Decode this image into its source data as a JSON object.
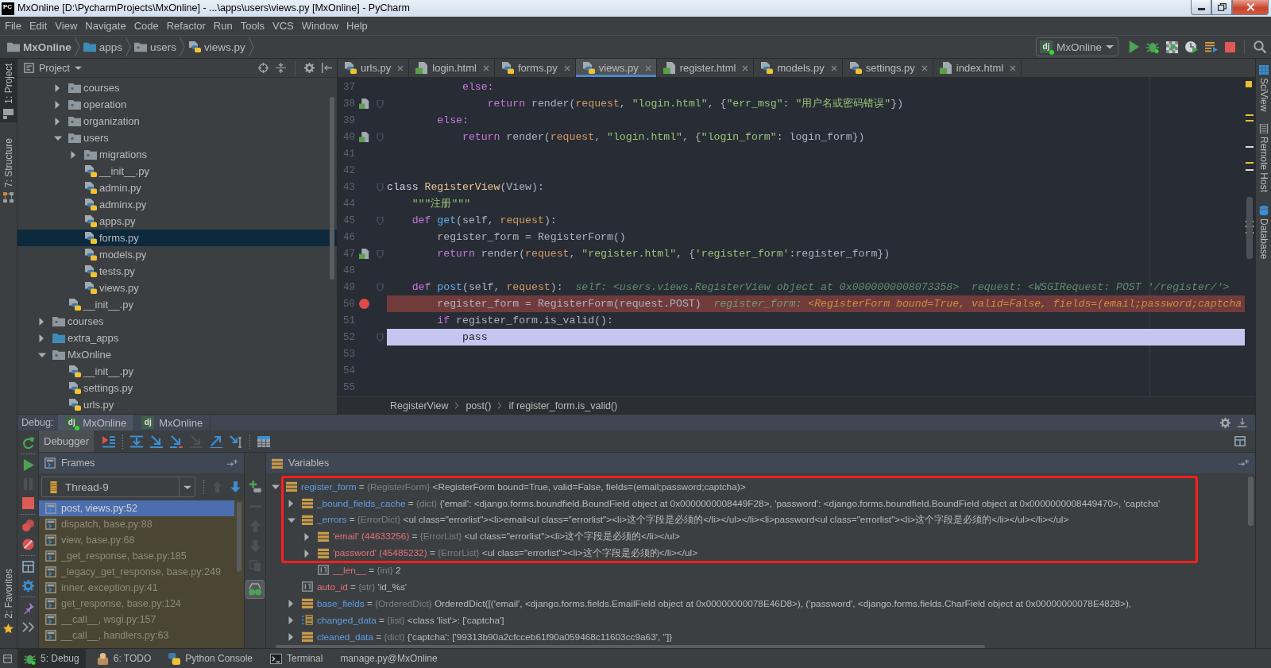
{
  "window": {
    "logo_text": "PC",
    "title": "MxOnline [D:\\PycharmProjects\\MxOnline] - ...\\apps\\users\\views.py [MxOnline] - PyCharm"
  },
  "menu": [
    "File",
    "Edit",
    "View",
    "Navigate",
    "Code",
    "Refactor",
    "Run",
    "Tools",
    "VCS",
    "Window",
    "Help"
  ],
  "navigation_bar": {
    "breadcrumbs": [
      {
        "label": "MxOnline",
        "kind": "project"
      },
      {
        "label": "apps",
        "kind": "source_folder"
      },
      {
        "label": "users",
        "kind": "package"
      },
      {
        "label": "views.py",
        "kind": "python_file"
      }
    ],
    "run_configuration": {
      "logo_text": "dj",
      "label": "MxOnline",
      "running": true
    }
  },
  "left_tool_strip": {
    "top": [
      {
        "label": "1: Project",
        "kind": "project",
        "selected": true
      },
      {
        "label": "7: Structure",
        "kind": "structure",
        "selected": false
      }
    ],
    "bottom": [
      {
        "label": "2: Favorites",
        "kind": "favorites",
        "selected": false
      }
    ]
  },
  "project_panel": {
    "title": "Project",
    "tree": [
      {
        "children": [
          {
            "label": "courses",
            "kind": "package",
            "expanded": false,
            "selected": false
          },
          {
            "label": "operation",
            "kind": "package",
            "expanded": false,
            "selected": false
          },
          {
            "label": "organization",
            "kind": "package",
            "expanded": false,
            "selected": false
          },
          {
            "label": "users",
            "kind": "package",
            "expanded": true,
            "selected": false,
            "children": [
              {
                "label": "migrations",
                "kind": "package",
                "expanded": false,
                "selected": false
              },
              {
                "label": "__init__.py",
                "kind": "python_file",
                "selected": false
              },
              {
                "label": "admin.py",
                "kind": "python_file",
                "selected": false
              },
              {
                "label": "adminx.py",
                "kind": "python_file",
                "selected": false
              },
              {
                "label": "apps.py",
                "kind": "python_file",
                "selected": false
              },
              {
                "label": "forms.py",
                "kind": "python_file",
                "selected": true
              },
              {
                "label": "models.py",
                "kind": "python_file",
                "selected": false
              },
              {
                "label": "tests.py",
                "kind": "python_file",
                "selected": false
              },
              {
                "label": "views.py",
                "kind": "python_file",
                "selected": false
              }
            ]
          },
          {
            "label": "__init__.py",
            "kind": "python_file",
            "selected": false
          }
        ]
      },
      {
        "label": "courses",
        "kind": "package",
        "expanded": false,
        "selected": false
      },
      {
        "label": "extra_apps",
        "kind": "source_folder",
        "expanded": false,
        "selected": false
      },
      {
        "label": "MxOnline",
        "kind": "package",
        "expanded": true,
        "selected": false,
        "children": [
          {
            "label": "__init__.py",
            "kind": "python_file",
            "selected": false
          },
          {
            "label": "settings.py",
            "kind": "python_file",
            "selected": false
          },
          {
            "label": "urls.py",
            "kind": "python_file",
            "selected": false
          }
        ]
      }
    ]
  },
  "editor": {
    "tabs": [
      {
        "label": "urls.py",
        "kind": "python",
        "selected": false
      },
      {
        "label": "login.html",
        "kind": "html",
        "selected": false
      },
      {
        "label": "forms.py",
        "kind": "python",
        "selected": false
      },
      {
        "label": "views.py",
        "kind": "python",
        "selected": true
      },
      {
        "label": "register.html",
        "kind": "html",
        "selected": false
      },
      {
        "label": "models.py",
        "kind": "python",
        "selected": false
      },
      {
        "label": "settings.py",
        "kind": "python",
        "selected": false
      },
      {
        "label": "index.html",
        "kind": "html",
        "selected": false
      }
    ],
    "lines": [
      {
        "number": "37",
        "tokens": [
          {
            "kind": "keyword",
            "text": "            else:"
          }
        ],
        "breakpoint": false,
        "execution_point": false,
        "template_link": false,
        "fold": false
      },
      {
        "number": "38",
        "tokens": [
          {
            "kind": "keyword",
            "text": "                return"
          },
          {
            "kind": "plain",
            "text": " render("
          },
          {
            "kind": "param",
            "text": "request"
          },
          {
            "kind": "plain",
            "text": ", "
          },
          {
            "kind": "string",
            "text": "\"login.html\""
          },
          {
            "kind": "plain",
            "text": ", {"
          },
          {
            "kind": "string",
            "text": "\"err_msg\""
          },
          {
            "kind": "plain",
            "text": ": "
          },
          {
            "kind": "string",
            "text": "\"用户名或密码错误\""
          },
          {
            "kind": "plain",
            "text": "})"
          }
        ],
        "breakpoint": false,
        "execution_point": false,
        "template_link": true,
        "fold": true
      },
      {
        "number": "39",
        "tokens": [
          {
            "kind": "keyword",
            "text": "        else:"
          }
        ],
        "breakpoint": false,
        "execution_point": false,
        "template_link": false,
        "fold": false
      },
      {
        "number": "40",
        "tokens": [
          {
            "kind": "keyword",
            "text": "            return"
          },
          {
            "kind": "plain",
            "text": " render("
          },
          {
            "kind": "param",
            "text": "request"
          },
          {
            "kind": "plain",
            "text": ", "
          },
          {
            "kind": "string",
            "text": "\"login.html\""
          },
          {
            "kind": "plain",
            "text": ", {"
          },
          {
            "kind": "string",
            "text": "\"login_form\""
          },
          {
            "kind": "plain",
            "text": ": login_form})"
          }
        ],
        "breakpoint": false,
        "execution_point": false,
        "template_link": true,
        "fold": true
      },
      {
        "number": "41",
        "breakpoint": false,
        "execution_point": false,
        "template_link": false,
        "fold": false
      },
      {
        "number": "42",
        "breakpoint": false,
        "execution_point": false,
        "template_link": false,
        "fold": false
      },
      {
        "number": "43",
        "tokens": [
          {
            "kind": "declaration",
            "text": "class "
          },
          {
            "kind": "class_name",
            "text": "RegisterView"
          },
          {
            "kind": "plain",
            "text": "(View):"
          }
        ],
        "breakpoint": false,
        "execution_point": false,
        "template_link": false,
        "fold": true
      },
      {
        "number": "44",
        "tokens": [
          {
            "kind": "string",
            "text": "    \"\"\"注册\"\"\""
          }
        ],
        "breakpoint": false,
        "execution_point": false,
        "template_link": false,
        "fold": false
      },
      {
        "number": "45",
        "tokens": [
          {
            "kind": "keyword",
            "text": "    def "
          },
          {
            "kind": "function",
            "text": "get"
          },
          {
            "kind": "plain",
            "text": "(self, "
          },
          {
            "kind": "param",
            "text": "request"
          },
          {
            "kind": "plain",
            "text": "):"
          }
        ],
        "breakpoint": false,
        "execution_point": false,
        "template_link": false,
        "fold": true
      },
      {
        "number": "46",
        "tokens": [
          {
            "kind": "plain",
            "text": "        register_form = RegisterForm()"
          }
        ],
        "breakpoint": false,
        "execution_point": false,
        "template_link": false,
        "fold": false
      },
      {
        "number": "47",
        "tokens": [
          {
            "kind": "keyword",
            "text": "        return"
          },
          {
            "kind": "plain",
            "text": " render("
          },
          {
            "kind": "param",
            "text": "request"
          },
          {
            "kind": "plain",
            "text": ", "
          },
          {
            "kind": "string",
            "text": "\"register.html\""
          },
          {
            "kind": "plain",
            "text": ", {"
          },
          {
            "kind": "string",
            "text": "'register_form'"
          },
          {
            "kind": "plain",
            "text": ":register_form})"
          }
        ],
        "breakpoint": false,
        "execution_point": false,
        "template_link": true,
        "fold": true
      },
      {
        "number": "48",
        "breakpoint": false,
        "execution_point": false,
        "template_link": false,
        "fold": false
      },
      {
        "number": "49",
        "tokens": [
          {
            "kind": "keyword",
            "text": "    def "
          },
          {
            "kind": "function",
            "text": "post"
          },
          {
            "kind": "plain",
            "text": "(self, "
          },
          {
            "kind": "param",
            "text": "request"
          },
          {
            "kind": "plain",
            "text": "):"
          }
        ],
        "inline_values": [
          {
            "kind": "hint",
            "text": "self: <users.views.RegisterView object at 0x0000000008073358>  request: <WSGIRequest: POST '/register/'>"
          }
        ],
        "breakpoint": false,
        "execution_point": false,
        "template_link": false,
        "fold": true
      },
      {
        "number": "50",
        "tokens": [
          {
            "kind": "plain",
            "text": "        register_form = RegisterForm(request.POST)"
          }
        ],
        "inline_values": [
          {
            "kind": "name",
            "text": "register_form:"
          },
          {
            "kind": "value",
            "text": "<RegisterForm bound=True, valid=False, fields=(email;password;captcha"
          }
        ],
        "breakpoint": true,
        "execution_point": false,
        "template_link": false,
        "fold": false
      },
      {
        "number": "51",
        "tokens": [
          {
            "kind": "keyword",
            "text": "        if"
          },
          {
            "kind": "plain",
            "text": " register_form.is_valid():"
          }
        ],
        "breakpoint": false,
        "execution_point": false,
        "template_link": false,
        "fold": false
      },
      {
        "number": "52",
        "tokens": [
          {
            "kind": "keyword",
            "text": "            pass"
          }
        ],
        "breakpoint": false,
        "execution_point": true,
        "template_link": false,
        "fold": true
      },
      {
        "number": "53",
        "breakpoint": false,
        "execution_point": false,
        "template_link": false,
        "fold": false
      },
      {
        "number": "54",
        "breakpoint": false,
        "execution_point": false,
        "template_link": false,
        "fold": false
      },
      {
        "number": "55",
        "breakpoint": false,
        "execution_point": false,
        "template_link": false,
        "fold": false
      }
    ],
    "breadcrumbs": [
      "RegisterView",
      "post()",
      "if register_form.is_valid()"
    ]
  },
  "right_tool_strip": [
    {
      "label": "SciView",
      "kind": "sciview"
    },
    {
      "label": "Remote Host",
      "kind": "remote_host"
    },
    {
      "label": "Database",
      "kind": "database"
    }
  ],
  "debug": {
    "label": "Debug:",
    "sessions": [
      {
        "logo_text": "dj",
        "label": "MxOnline",
        "running": true,
        "selected": true
      },
      {
        "logo_text": "dj",
        "label": "MxOnline",
        "running": false,
        "selected": false
      }
    ],
    "side_toolbar": [
      {
        "kind": "rerun",
        "disabled": false
      },
      {
        "kind": "separator"
      },
      {
        "kind": "resume",
        "disabled": false
      },
      {
        "kind": "pause",
        "disabled": true
      },
      {
        "kind": "stop",
        "disabled": false
      },
      {
        "kind": "separator"
      },
      {
        "kind": "view_breakpoints",
        "disabled": false
      },
      {
        "kind": "mute_breakpoints",
        "disabled": false
      },
      {
        "kind": "separator"
      },
      {
        "kind": "restore_layout",
        "disabled": false
      },
      {
        "kind": "settings",
        "disabled": false
      },
      {
        "kind": "separator"
      },
      {
        "kind": "pin",
        "disabled": false
      },
      {
        "kind": "more",
        "disabled": false
      }
    ],
    "toolbar_tab": {
      "label": "Debugger",
      "selected": true
    },
    "toolbar": [
      {
        "kind": "show_execution_point",
        "disabled": false
      },
      {
        "kind": "separator"
      },
      {
        "kind": "step_over",
        "disabled": false
      },
      {
        "kind": "step_into",
        "disabled": false
      },
      {
        "kind": "step_into_my_code",
        "disabled": false
      },
      {
        "kind": "force_step_into",
        "disabled": true
      },
      {
        "kind": "step_out",
        "disabled": false
      },
      {
        "kind": "run_to_cursor",
        "disabled": false
      },
      {
        "kind": "separator"
      },
      {
        "kind": "evaluate_expression",
        "disabled": false
      }
    ],
    "frames": {
      "title": "Frames",
      "thread": "Thread-9",
      "navigation": [
        {
          "kind": "previous_frame",
          "disabled": true
        },
        {
          "kind": "next_frame",
          "disabled": false
        }
      ],
      "items": [
        {
          "label": "post, views.py:52",
          "selected": true
        },
        {
          "label": "dispatch, base.py:88",
          "selected": false
        },
        {
          "label": "view, base.py:68",
          "selected": false
        },
        {
          "label": "_get_response, base.py:185",
          "selected": false
        },
        {
          "label": "_legacy_get_response, base.py:249",
          "selected": false
        },
        {
          "label": "inner, exception.py:41",
          "selected": false
        },
        {
          "label": "get_response, base.py:124",
          "selected": false
        },
        {
          "label": "__call__, wsgi.py:157",
          "selected": false
        },
        {
          "label": "__call__, handlers.py:63",
          "selected": false
        }
      ]
    },
    "watch_toolbar": [
      {
        "kind": "add_watch",
        "disabled": false,
        "pressed": false
      },
      {
        "kind": "remove_watch",
        "disabled": true,
        "pressed": false
      },
      {
        "kind": "move_up",
        "disabled": true,
        "pressed": false
      },
      {
        "kind": "move_down",
        "disabled": true,
        "pressed": false
      },
      {
        "kind": "copy",
        "disabled": true,
        "pressed": false
      },
      {
        "kind": "show_watches",
        "disabled": false,
        "pressed": true
      }
    ],
    "variables": {
      "title": "Variables",
      "items": [
        {
          "name": "register_form",
          "operator": "=",
          "type": "{RegisterForm}",
          "value": "<RegisterForm bound=True, valid=False, fields=(email;password;captcha)>",
          "kind": "object",
          "expanded": true,
          "annotated": true,
          "children": [
            {
              "name": "_bound_fields_cache",
              "operator": "=",
              "type": "{dict}",
              "value": "{'email': <django.forms.boundfield.BoundField object at 0x0000000008449F28>, 'password': <django.forms.boundfield.BoundField object at 0x0000000008449470>, 'captcha'",
              "kind": "object",
              "expanded": false,
              "annotated": true
            },
            {
              "name": "_errors",
              "operator": "=",
              "type": "{ErrorDict}",
              "value": "<ul class=\"errorlist\"><li>email<ul class=\"errorlist\"><li>这个字段是必须的</li></ul></li><li>password<ul class=\"errorlist\"><li>这个字段是必须的</li></ul></li></ul>",
              "kind": "object",
              "expanded": true,
              "annotated": true,
              "children": [
                {
                  "name": "'email' (44633256)",
                  "operator": "=",
                  "type": "{ErrorList}",
                  "value": "<ul class=\"errorlist\"><li>这个字段是必须的</li></ul>",
                  "kind": "key",
                  "expanded": false,
                  "annotated": true
                },
                {
                  "name": "'password' (45485232)",
                  "operator": "=",
                  "type": "{ErrorList}",
                  "value": "<ul class=\"errorlist\"><li>这个字段是必须的</li></ul>",
                  "kind": "key",
                  "expanded": false,
                  "annotated": true
                },
                {
                  "name": "__len__",
                  "operator": "=",
                  "type": "{int}",
                  "value": "2",
                  "kind": "number",
                  "annotated": false
                }
              ]
            },
            {
              "name": "auto_id",
              "operator": "=",
              "type": "{str}",
              "value": "'id_%s'",
              "kind": "number",
              "annotated": false
            },
            {
              "name": "base_fields",
              "operator": "=",
              "type": "{OrderedDict}",
              "value": "OrderedDict([('email', <django.forms.fields.EmailField object at 0x00000000078E46D8>), ('password', <django.forms.fields.CharField object at 0x00000000078E4828>),",
              "kind": "object",
              "expanded": false,
              "annotated": false
            },
            {
              "name": "changed_data",
              "operator": "=",
              "type": "{list}",
              "value": "<class 'list'>: ['captcha']",
              "kind": "list",
              "expanded": false,
              "annotated": false
            },
            {
              "name": "cleaned_data",
              "operator": "=",
              "type": "{dict}",
              "value": "{'captcha': ['99313b90a2cfcceb61f90a059468c11603cc9a63', '']}",
              "kind": "object",
              "expanded": false,
              "annotated": false
            }
          ]
        }
      ]
    }
  },
  "status_bar": [
    {
      "label": "5: Debug",
      "kind": "debug",
      "selected": true
    },
    {
      "label": "6: TODO",
      "kind": "todo",
      "selected": false
    },
    {
      "label": "Python Console",
      "kind": "python_console",
      "selected": false
    },
    {
      "label": "Terminal",
      "kind": "terminal",
      "selected": false
    },
    {
      "label": "manage.py@MxOnline",
      "kind": "run_task",
      "selected": false
    }
  ]
}
